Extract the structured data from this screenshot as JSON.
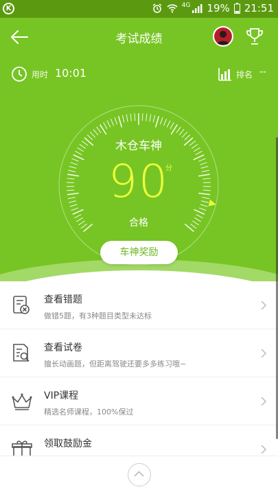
{
  "statusbar": {
    "k_badge": "K",
    "network": "4G",
    "battery": "19%",
    "time": "21:51"
  },
  "header": {
    "title": "考试成绩"
  },
  "stats": {
    "time_label": "用时",
    "time_value": "10:01",
    "rank_label": "排名",
    "rank_value": "--"
  },
  "result": {
    "rank_title": "木仓车神",
    "score": "90",
    "unit": "分",
    "status": "合格",
    "reward_button": "车神奖励"
  },
  "menu": [
    {
      "title": "查看错题",
      "subtitle": "做错5题，有3种题目类型未达标",
      "icon": "wrong-questions-icon"
    },
    {
      "title": "查看试卷",
      "subtitle": "擅长动画题，但距离驾驶还要多多练习哦~",
      "icon": "exam-paper-icon"
    },
    {
      "title": "VIP课程",
      "subtitle": "精选名师课程，100%保过",
      "icon": "crown-icon"
    },
    {
      "title": "领取鼓励金",
      "subtitle": "",
      "icon": "gift-icon"
    }
  ],
  "colors": {
    "primary": "#77c524",
    "score": "#eaff3c",
    "statusbar": "#5b9a10"
  }
}
